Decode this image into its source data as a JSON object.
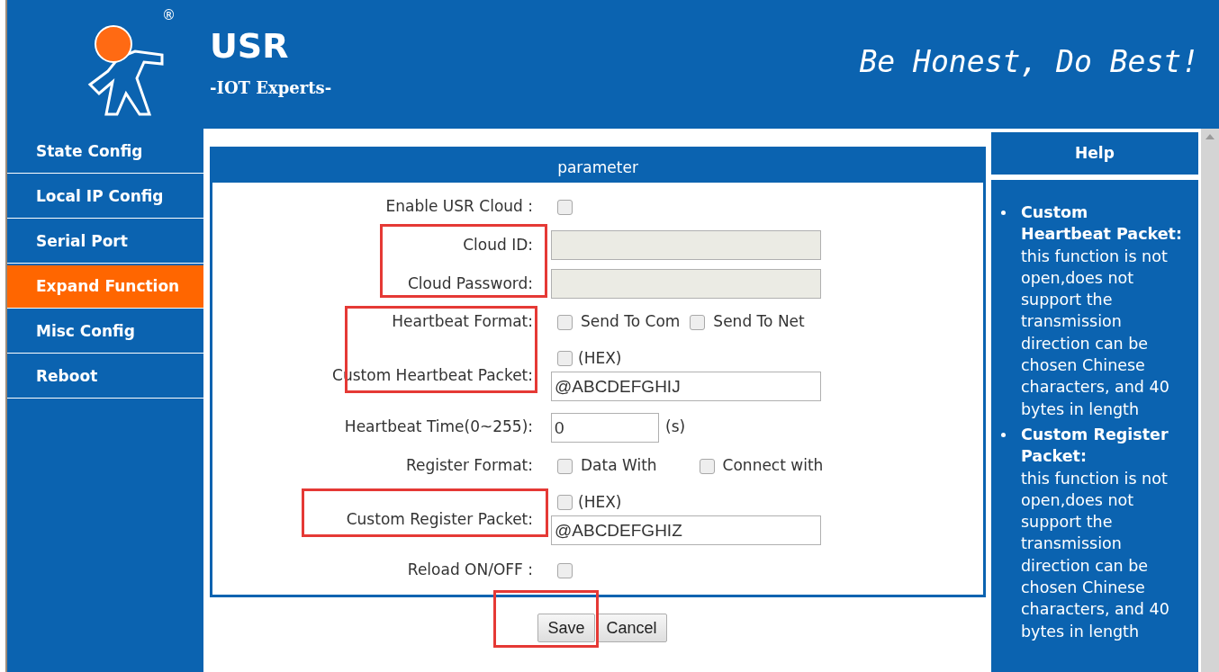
{
  "header": {
    "brand": "USR",
    "tagline": "-IOT Experts-",
    "slogan": "Be Honest, Do Best!",
    "registered_mark": "®"
  },
  "sidebar": {
    "items": [
      {
        "label": "State Config",
        "selected": false
      },
      {
        "label": "Local IP Config",
        "selected": false
      },
      {
        "label": "Serial Port",
        "selected": false
      },
      {
        "label": "Expand Function",
        "selected": true
      },
      {
        "label": "Misc Config",
        "selected": false
      },
      {
        "label": "Reboot",
        "selected": false
      }
    ]
  },
  "panel": {
    "title": "parameter",
    "rows": [
      {
        "kind": "checkbox",
        "label": "Enable USR Cloud :",
        "checked": false
      },
      {
        "kind": "input",
        "label": "Cloud ID:",
        "disabled": true
      },
      {
        "kind": "input",
        "label": "Cloud Password:",
        "disabled": true
      },
      {
        "kind": "options",
        "label": "Heartbeat Format:",
        "options": [
          {
            "label": "Send To Com",
            "checked": false
          },
          {
            "label": "Send To Net",
            "checked": false
          }
        ]
      },
      {
        "kind": "packet",
        "label": "Custom Heartbeat Packet:",
        "hex_label": "(HEX)",
        "hex_checked": false,
        "value": "@ABCDEFGHIJ"
      },
      {
        "kind": "time",
        "label": "Heartbeat Time(0~255):",
        "value": "0",
        "unit": "(s)"
      },
      {
        "kind": "options",
        "label": "Register Format:",
        "options": [
          {
            "label": "Data With",
            "checked": false
          },
          {
            "label": "Connect with",
            "checked": false
          }
        ]
      },
      {
        "kind": "packet",
        "label": "Custom Register Packet:",
        "hex_label": "(HEX)",
        "hex_checked": false,
        "value": "@ABCDEFGHIZ"
      },
      {
        "kind": "checkbox",
        "label": "Reload ON/OFF :",
        "checked": false
      }
    ],
    "buttons": [
      "Save",
      "Cancel"
    ]
  },
  "help": {
    "title": "Help",
    "items": [
      {
        "heading": "Custom Heartbeat Packet:",
        "text": "this function is not open,does not support the transmission direction can be chosen Chinese characters, and 40 bytes in length"
      },
      {
        "heading": "Custom Register Packet:",
        "text": "this function is not open,does not support the transmission direction can be chosen Chinese characters, and 40 bytes in length"
      }
    ]
  }
}
